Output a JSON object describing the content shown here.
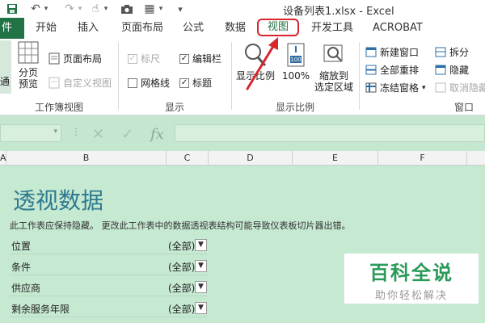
{
  "titlebar": {
    "doc_title": "设备列表1.xlsx - Excel",
    "quick_access": [
      {
        "name": "save-icon",
        "glyph": "💾"
      },
      {
        "name": "undo-icon",
        "glyph": "↶"
      },
      {
        "name": "dropdown-icon",
        "glyph": "▾"
      },
      {
        "name": "redo-icon",
        "glyph": "↷"
      },
      {
        "name": "dropdown-icon",
        "glyph": "▾"
      },
      {
        "name": "touch-mode-icon",
        "glyph": "☝"
      },
      {
        "name": "dropdown-icon",
        "glyph": "▾"
      },
      {
        "name": "camera-icon",
        "glyph": "📷"
      },
      {
        "name": "layout-icon",
        "glyph": "▦"
      },
      {
        "name": "customize-icon",
        "glyph": "▾"
      }
    ]
  },
  "tabs": {
    "file": "件",
    "items": [
      "开始",
      "插入",
      "页面布局",
      "公式",
      "数据",
      "视图",
      "开发工具",
      "ACROBAT"
    ],
    "active": "视图"
  },
  "ribbon": {
    "workbook_views": {
      "label": "工作簿视图",
      "normal": "通",
      "page_break": [
        "分页",
        "预览"
      ],
      "page_layout": "页面布局",
      "custom_views": "自定义视图"
    },
    "show": {
      "label": "显示",
      "ruler": "标尺",
      "gridlines": "网格线",
      "formula_bar": "编辑栏",
      "headings": "标题"
    },
    "zoom": {
      "label": "显示比例",
      "zoom": "显示比例",
      "hundred": "100%",
      "hundred_icon_text": "100",
      "zoom_to_selection": [
        "缩放到",
        "选定区域"
      ]
    },
    "window": {
      "label": "窗口",
      "new_window": "新建窗口",
      "arrange_all": "全部重排",
      "freeze_panes": "冻结窗格",
      "split": "拆分",
      "hide": "隐藏",
      "unhide": "取消隐藏"
    }
  },
  "formula_bar": {
    "fx": "fx",
    "cancel": "✕",
    "enter": "✓"
  },
  "columns": [
    "A",
    "B",
    "C",
    "D",
    "E",
    "F"
  ],
  "sheet": {
    "title": "透视数据",
    "note": "此工作表应保持隐藏。 更改此工作表中的数据透视表结构可能导致仪表板切片器出错。",
    "filters": [
      {
        "name": "位置",
        "value": "(全部)"
      },
      {
        "name": "条件",
        "value": "(全部)"
      },
      {
        "name": "供应商",
        "value": "(全部)"
      },
      {
        "name": "剩余服务年限",
        "value": "(全部)"
      }
    ]
  },
  "watermark": {
    "title": "百科全说",
    "subtitle": "助你轻松解决"
  },
  "colors": {
    "excel_green": "#217346",
    "highlight_red": "#d9252b",
    "sheet_bg": "#c6e9d1",
    "title_blue": "#2e7a8f"
  }
}
